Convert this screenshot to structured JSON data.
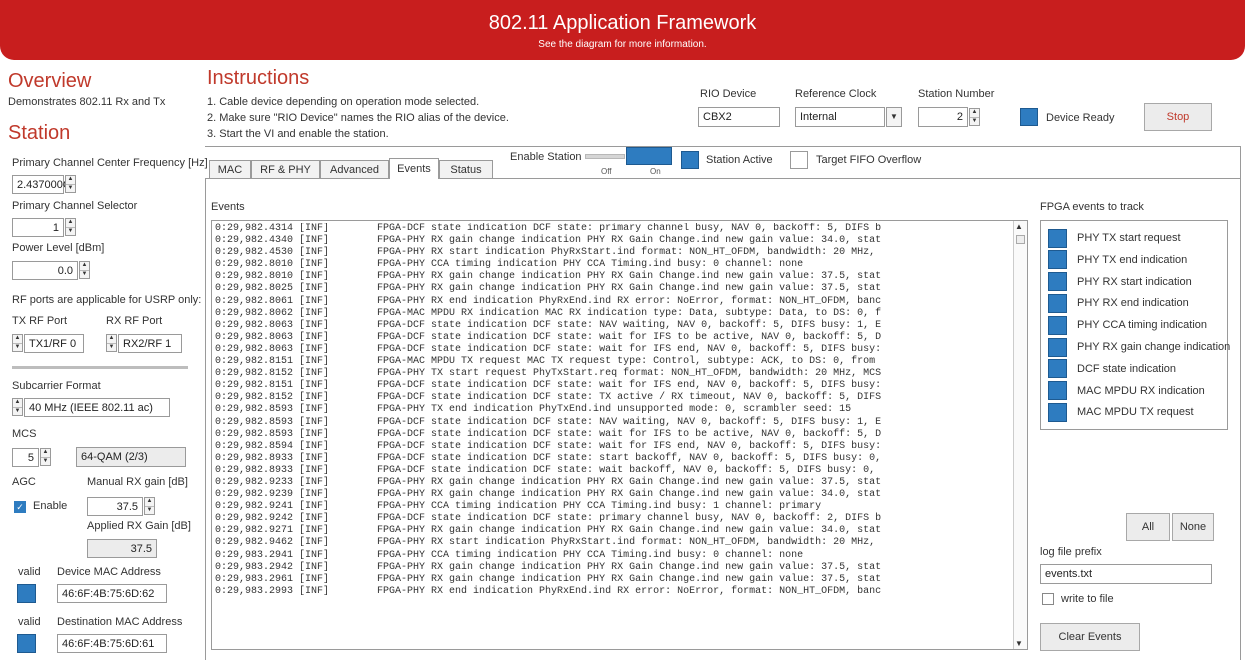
{
  "header": {
    "title": "802.11 Application Framework",
    "subtitle": "See the diagram for more information."
  },
  "overview": {
    "title": "Overview",
    "description": "Demonstrates 802.11 Rx and Tx"
  },
  "station": {
    "title": "Station"
  },
  "instructions": {
    "title": "Instructions",
    "steps": [
      "1. Cable device depending on operation mode selected.",
      "2. Make sure \"RIO Device\" names the RIO alias of the device.",
      "3. Start the VI and enable the station."
    ]
  },
  "device": {
    "rio_label": "RIO Device",
    "rio_value": "CBX2",
    "clock_label": "Reference Clock",
    "clock_value": "Internal",
    "station_label": "Station Number",
    "station_value": "2",
    "ready_label": "Device Ready",
    "stop_label": "Stop"
  },
  "left": {
    "freq_label": "Primary Channel Center Frequency [Hz]",
    "freq_value": "2.437000G",
    "chan_label": "Primary Channel Selector",
    "chan_value": "1",
    "power_label": "Power Level [dBm]",
    "power_value": "0.0",
    "rf_note": "RF ports are applicable for USRP only:",
    "tx_port_label": "TX RF Port",
    "tx_port_value": "TX1/RF 0",
    "rx_port_label": "RX RF Port",
    "rx_port_value": "RX2/RF 1",
    "subcarrier_label": "Subcarrier Format",
    "subcarrier_value": "40 MHz (IEEE 802.11 ac)",
    "mcs_label": "MCS",
    "mcs_value": "5",
    "mcs_text": "64-QAM (2/3)",
    "agc_label": "AGC",
    "enable_label": "Enable",
    "manual_gain_label": "Manual RX gain [dB]",
    "manual_gain_value": "37.5",
    "applied_gain_label": "Applied RX Gain [dB]",
    "applied_gain_value": "37.5",
    "valid1": "valid",
    "device_mac_label": "Device MAC Address",
    "device_mac_value": "46:6F:4B:75:6D:62",
    "valid2": "valid",
    "dest_mac_label": "Destination MAC Address",
    "dest_mac_value": "46:6F:4B:75:6D:61"
  },
  "tabs": [
    "MAC",
    "RF & PHY",
    "Advanced",
    "Events",
    "Status"
  ],
  "station_ctrl": {
    "enable_label": "Enable Station",
    "off_label": "Off",
    "on_label": "On",
    "active_label": "Station Active",
    "overflow_label": "Target FIFO Overflow"
  },
  "events": {
    "label": "Events",
    "lines": [
      "0:29,982.4314 [INF]        FPGA-DCF state indication DCF state: primary channel busy, NAV 0, backoff: 5, DIFS b",
      "0:29,982.4340 [INF]        FPGA-PHY RX gain change indication PHY RX Gain Change.ind new gain value: 34.0, stat",
      "0:29,982.4530 [INF]        FPGA-PHY RX start indication PhyRxStart.ind format: NON_HT_OFDM, bandwidth: 20 MHz,",
      "0:29,982.8010 [INF]        FPGA-PHY CCA timing indication PHY CCA Timing.ind busy: 0 channel: none",
      "0:29,982.8010 [INF]        FPGA-PHY RX gain change indication PHY RX Gain Change.ind new gain value: 37.5, stat",
      "0:29,982.8025 [INF]        FPGA-PHY RX gain change indication PHY RX Gain Change.ind new gain value: 37.5, stat",
      "0:29,982.8061 [INF]        FPGA-PHY RX end indication PhyRxEnd.ind RX error: NoError, format: NON_HT_OFDM, banc",
      "0:29,982.8062 [INF]        FPGA-MAC MPDU RX indication MAC RX indication type: Data, subtype: Data, to DS: 0, f",
      "0:29,982.8063 [INF]        FPGA-DCF state indication DCF state: NAV waiting, NAV 0, backoff: 5, DIFS busy: 1, E",
      "0:29,982.8063 [INF]        FPGA-DCF state indication DCF state: wait for IFS to be active, NAV 0, backoff: 5, D",
      "0:29,982.8063 [INF]        FPGA-DCF state indication DCF state: wait for IFS end, NAV 0, backoff: 5, DIFS busy:",
      "0:29,982.8151 [INF]        FPGA-MAC MPDU TX request MAC TX request type: Control, subtype: ACK, to DS: 0, from",
      "0:29,982.8152 [INF]        FPGA-PHY TX start request PhyTxStart.req format: NON_HT_OFDM, bandwidth: 20 MHz, MCS",
      "0:29,982.8151 [INF]        FPGA-DCF state indication DCF state: wait for IFS end, NAV 0, backoff: 5, DIFS busy:",
      "0:29,982.8152 [INF]        FPGA-DCF state indication DCF state: TX active / RX timeout, NAV 0, backoff: 5, DIFS",
      "0:29,982.8593 [INF]        FPGA-PHY TX end indication PhyTxEnd.ind unsupported mode: 0, scrambler seed: 15",
      "0:29,982.8593 [INF]        FPGA-DCF state indication DCF state: NAV waiting, NAV 0, backoff: 5, DIFS busy: 1, E",
      "0:29,982.8593 [INF]        FPGA-DCF state indication DCF state: wait for IFS to be active, NAV 0, backoff: 5, D",
      "0:29,982.8594 [INF]        FPGA-DCF state indication DCF state: wait for IFS end, NAV 0, backoff: 5, DIFS busy:",
      "0:29,982.8933 [INF]        FPGA-DCF state indication DCF state: start backoff, NAV 0, backoff: 5, DIFS busy: 0,",
      "0:29,982.8933 [INF]        FPGA-DCF state indication DCF state: wait backoff, NAV 0, backoff: 5, DIFS busy: 0,",
      "0:29,982.9233 [INF]        FPGA-PHY RX gain change indication PHY RX Gain Change.ind new gain value: 37.5, stat",
      "0:29,982.9239 [INF]        FPGA-PHY RX gain change indication PHY RX Gain Change.ind new gain value: 34.0, stat",
      "0:29,982.9241 [INF]        FPGA-PHY CCA timing indication PHY CCA Timing.ind busy: 1 channel: primary",
      "0:29,982.9242 [INF]        FPGA-DCF state indication DCF state: primary channel busy, NAV 0, backoff: 2, DIFS b",
      "0:29,982.9271 [INF]        FPGA-PHY RX gain change indication PHY RX Gain Change.ind new gain value: 34.0, stat",
      "0:29,982.9462 [INF]        FPGA-PHY RX start indication PhyRxStart.ind format: NON_HT_OFDM, bandwidth: 20 MHz,",
      "0:29,983.2941 [INF]        FPGA-PHY CCA timing indication PHY CCA Timing.ind busy: 0 channel: none",
      "0:29,983.2942 [INF]        FPGA-PHY RX gain change indication PHY RX Gain Change.ind new gain value: 37.5, stat",
      "0:29,983.2961 [INF]        FPGA-PHY RX gain change indication PHY RX Gain Change.ind new gain value: 37.5, stat",
      "0:29,983.2993 [INF]        FPGA-PHY RX end indication PhyRxEnd.ind RX error: NoError, format: NON_HT_OFDM, banc"
    ]
  },
  "fpga": {
    "title": "FPGA events to track",
    "items": [
      "PHY TX start request",
      "PHY TX end indication",
      "PHY RX start indication",
      "PHY RX end indication",
      "PHY CCA timing indication",
      "PHY RX gain change indication",
      "DCF state indication",
      "MAC MPDU RX indication",
      "MAC MPDU TX request"
    ],
    "all_label": "All",
    "none_label": "None",
    "log_prefix_label": "log file prefix",
    "log_prefix_value": "events.txt",
    "write_label": "write to file",
    "clear_label": "Clear Events"
  },
  "colors": {
    "banner": "#c81e1e",
    "accent": "#2e7cc0",
    "title": "#c0392b"
  }
}
